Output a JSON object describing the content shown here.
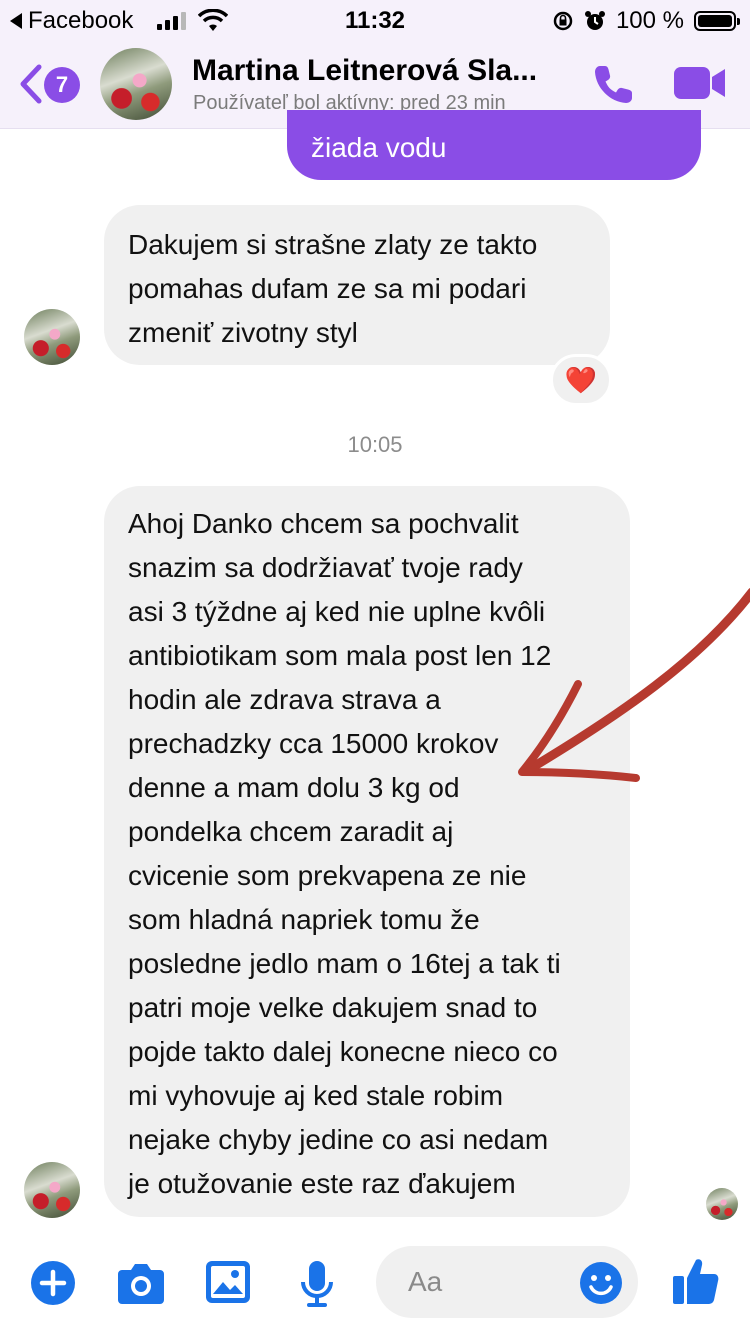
{
  "status_bar": {
    "back_app": "Facebook",
    "time": "11:32",
    "battery": "100 %"
  },
  "header": {
    "unread_count": "7",
    "contact_name": "Martina Leitnerová Sla...",
    "contact_status": "Používateľ bol aktívny: pred 23 min"
  },
  "messages": {
    "sent_partial": "žiada vodu",
    "msg1_lines": [
      "Dakujem si strašne zlaty ze takto",
      "pomahas dufam ze sa mi podari",
      "zmeniť zivotny styl"
    ],
    "msg1_reaction": "❤️",
    "timestamp": "10:05",
    "msg2_lines": [
      "Ahoj Danko chcem sa pochvalit",
      "snazim sa dodržiavať tvoje rady",
      "asi 3 týždne aj ked nie uplne kvôli",
      "antibiotikam som mala post len 12",
      "hodin ale zdrava strava a",
      "prechadzky  cca 15000 krokov",
      "denne a mam dolu 3 kg od",
      "pondelka chcem zaradit aj",
      "cvicenie som prekvapena ze nie",
      "som hladná napriek tomu že",
      "posledne jedlo mam o 16tej a tak ti",
      "patri moje velke dakujem snad to",
      "pojde takto dalej konecne nieco co",
      "mi vyhovuje aj ked stale robim",
      "nejake chyby jedine co asi nedam",
      "je otužovanie este raz ďakujem"
    ]
  },
  "composer": {
    "placeholder": "Aa"
  },
  "colors": {
    "accent": "#8a4de6",
    "action_blue": "#1a73e8",
    "bubble_gray": "#f0f0f0",
    "arrow_red": "#b63a2f"
  },
  "icons": [
    "back-triangle-icon",
    "signal-icon",
    "wifi-icon",
    "lock-rotation-icon",
    "alarm-icon",
    "battery-icon",
    "back-chevron-icon",
    "phone-icon",
    "video-icon",
    "plus-icon",
    "camera-icon",
    "gallery-icon",
    "microphone-icon",
    "emoji-icon",
    "thumbs-up-icon"
  ]
}
